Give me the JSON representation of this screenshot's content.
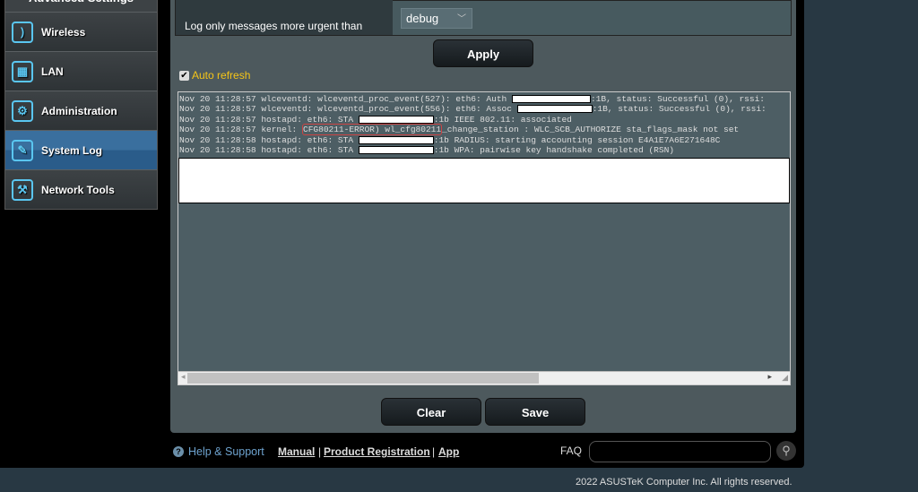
{
  "sidebar": {
    "header": "Advanced Settings",
    "items": [
      {
        "label": "Wireless",
        "icon": "wifi-icon"
      },
      {
        "label": "LAN",
        "icon": "lan-icon"
      },
      {
        "label": "Administration",
        "icon": "gear-icon"
      },
      {
        "label": "System Log",
        "icon": "log-icon",
        "active": true
      },
      {
        "label": "Network Tools",
        "icon": "tools-icon"
      }
    ]
  },
  "settings": {
    "log_level_label": "Log only messages more urgent than",
    "log_level_value": "debug",
    "apply": "Apply",
    "auto_refresh": "Auto refresh",
    "auto_refresh_checked": true
  },
  "log": {
    "lines": [
      {
        "pre": "Nov 20 11:28:57 wlceventd: wlceventd_proc_event(527): eth6: Auth ",
        "post": ":1B, status: Successful (0), rssi:"
      },
      {
        "pre": "Nov 20 11:28:57 wlceventd: wlceventd_proc_event(556): eth6: Assoc ",
        "post": ":1B, status: Successful (0), rssi:"
      },
      {
        "pre": "Nov 20 11:28:57 hostapd: eth6: STA ",
        "post": ":1b IEEE 802.11: associated"
      },
      {
        "pre": "Nov 20 11:28:57 kernel: ",
        "err": "CFG80211-ERROR) wl_cfg80211",
        "post": "_change_station : WLC_SCB_AUTHORIZE sta_flags_mask not set"
      },
      {
        "pre": "Nov 20 11:28:58 hostapd: eth6: STA ",
        "post": ":1b RADIUS: starting accounting session E4A1E7A6E271648C"
      },
      {
        "pre": "Nov 20 11:28:58 hostapd: eth6: STA ",
        "post": ":1b WPA: pairwise key handshake completed (RSN)"
      }
    ]
  },
  "actions": {
    "clear": "Clear",
    "save": "Save"
  },
  "footer": {
    "help": "Help & Support",
    "manual": "Manual",
    "product_registration": "Product Registration",
    "app": "App",
    "faq": "FAQ",
    "faq_placeholder": "",
    "copyright": "2022 ASUSTeK Computer Inc. All rights reserved."
  }
}
